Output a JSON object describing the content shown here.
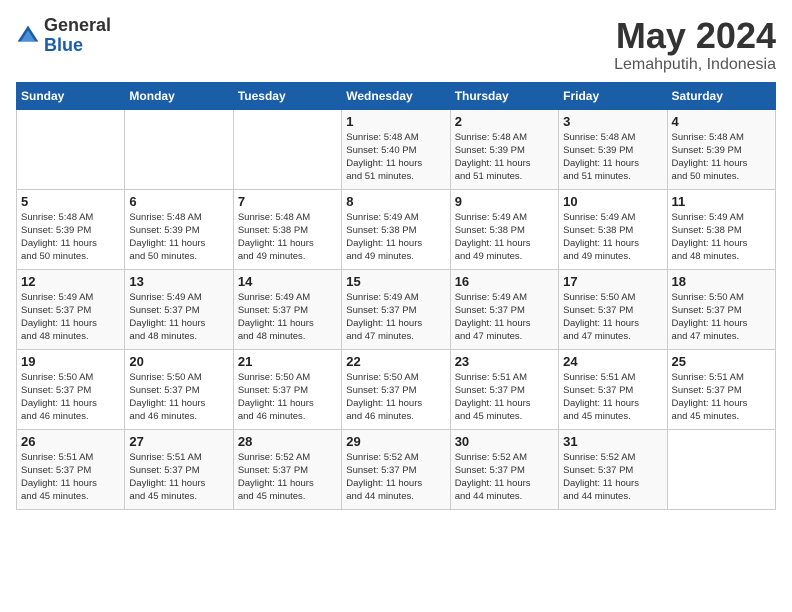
{
  "logo": {
    "general": "General",
    "blue": "Blue"
  },
  "title": "May 2024",
  "subtitle": "Lemahputih, Indonesia",
  "days_of_week": [
    "Sunday",
    "Monday",
    "Tuesday",
    "Wednesday",
    "Thursday",
    "Friday",
    "Saturday"
  ],
  "weeks": [
    [
      {
        "day": "",
        "info": ""
      },
      {
        "day": "",
        "info": ""
      },
      {
        "day": "",
        "info": ""
      },
      {
        "day": "1",
        "info": "Sunrise: 5:48 AM\nSunset: 5:40 PM\nDaylight: 11 hours\nand 51 minutes."
      },
      {
        "day": "2",
        "info": "Sunrise: 5:48 AM\nSunset: 5:39 PM\nDaylight: 11 hours\nand 51 minutes."
      },
      {
        "day": "3",
        "info": "Sunrise: 5:48 AM\nSunset: 5:39 PM\nDaylight: 11 hours\nand 51 minutes."
      },
      {
        "day": "4",
        "info": "Sunrise: 5:48 AM\nSunset: 5:39 PM\nDaylight: 11 hours\nand 50 minutes."
      }
    ],
    [
      {
        "day": "5",
        "info": "Sunrise: 5:48 AM\nSunset: 5:39 PM\nDaylight: 11 hours\nand 50 minutes."
      },
      {
        "day": "6",
        "info": "Sunrise: 5:48 AM\nSunset: 5:39 PM\nDaylight: 11 hours\nand 50 minutes."
      },
      {
        "day": "7",
        "info": "Sunrise: 5:48 AM\nSunset: 5:38 PM\nDaylight: 11 hours\nand 49 minutes."
      },
      {
        "day": "8",
        "info": "Sunrise: 5:49 AM\nSunset: 5:38 PM\nDaylight: 11 hours\nand 49 minutes."
      },
      {
        "day": "9",
        "info": "Sunrise: 5:49 AM\nSunset: 5:38 PM\nDaylight: 11 hours\nand 49 minutes."
      },
      {
        "day": "10",
        "info": "Sunrise: 5:49 AM\nSunset: 5:38 PM\nDaylight: 11 hours\nand 49 minutes."
      },
      {
        "day": "11",
        "info": "Sunrise: 5:49 AM\nSunset: 5:38 PM\nDaylight: 11 hours\nand 48 minutes."
      }
    ],
    [
      {
        "day": "12",
        "info": "Sunrise: 5:49 AM\nSunset: 5:37 PM\nDaylight: 11 hours\nand 48 minutes."
      },
      {
        "day": "13",
        "info": "Sunrise: 5:49 AM\nSunset: 5:37 PM\nDaylight: 11 hours\nand 48 minutes."
      },
      {
        "day": "14",
        "info": "Sunrise: 5:49 AM\nSunset: 5:37 PM\nDaylight: 11 hours\nand 48 minutes."
      },
      {
        "day": "15",
        "info": "Sunrise: 5:49 AM\nSunset: 5:37 PM\nDaylight: 11 hours\nand 47 minutes."
      },
      {
        "day": "16",
        "info": "Sunrise: 5:49 AM\nSunset: 5:37 PM\nDaylight: 11 hours\nand 47 minutes."
      },
      {
        "day": "17",
        "info": "Sunrise: 5:50 AM\nSunset: 5:37 PM\nDaylight: 11 hours\nand 47 minutes."
      },
      {
        "day": "18",
        "info": "Sunrise: 5:50 AM\nSunset: 5:37 PM\nDaylight: 11 hours\nand 47 minutes."
      }
    ],
    [
      {
        "day": "19",
        "info": "Sunrise: 5:50 AM\nSunset: 5:37 PM\nDaylight: 11 hours\nand 46 minutes."
      },
      {
        "day": "20",
        "info": "Sunrise: 5:50 AM\nSunset: 5:37 PM\nDaylight: 11 hours\nand 46 minutes."
      },
      {
        "day": "21",
        "info": "Sunrise: 5:50 AM\nSunset: 5:37 PM\nDaylight: 11 hours\nand 46 minutes."
      },
      {
        "day": "22",
        "info": "Sunrise: 5:50 AM\nSunset: 5:37 PM\nDaylight: 11 hours\nand 46 minutes."
      },
      {
        "day": "23",
        "info": "Sunrise: 5:51 AM\nSunset: 5:37 PM\nDaylight: 11 hours\nand 45 minutes."
      },
      {
        "day": "24",
        "info": "Sunrise: 5:51 AM\nSunset: 5:37 PM\nDaylight: 11 hours\nand 45 minutes."
      },
      {
        "day": "25",
        "info": "Sunrise: 5:51 AM\nSunset: 5:37 PM\nDaylight: 11 hours\nand 45 minutes."
      }
    ],
    [
      {
        "day": "26",
        "info": "Sunrise: 5:51 AM\nSunset: 5:37 PM\nDaylight: 11 hours\nand 45 minutes."
      },
      {
        "day": "27",
        "info": "Sunrise: 5:51 AM\nSunset: 5:37 PM\nDaylight: 11 hours\nand 45 minutes."
      },
      {
        "day": "28",
        "info": "Sunrise: 5:52 AM\nSunset: 5:37 PM\nDaylight: 11 hours\nand 45 minutes."
      },
      {
        "day": "29",
        "info": "Sunrise: 5:52 AM\nSunset: 5:37 PM\nDaylight: 11 hours\nand 44 minutes."
      },
      {
        "day": "30",
        "info": "Sunrise: 5:52 AM\nSunset: 5:37 PM\nDaylight: 11 hours\nand 44 minutes."
      },
      {
        "day": "31",
        "info": "Sunrise: 5:52 AM\nSunset: 5:37 PM\nDaylight: 11 hours\nand 44 minutes."
      },
      {
        "day": "",
        "info": ""
      }
    ]
  ]
}
